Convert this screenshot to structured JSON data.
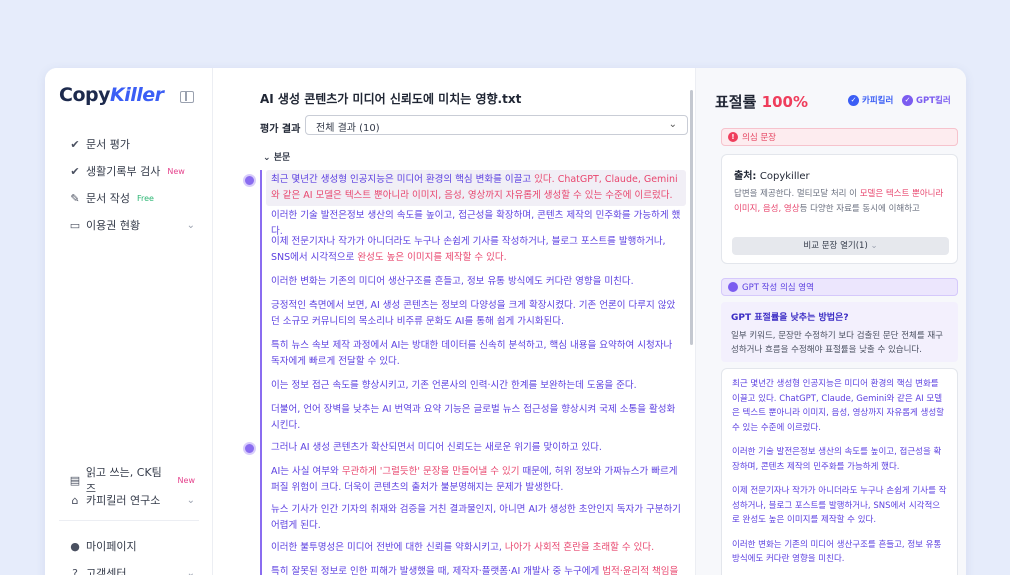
{
  "sidebar": {
    "logo": {
      "main": "Copy",
      "accent": "Killer"
    },
    "nav": [
      {
        "label": "문서 평가",
        "icon": "check-icon"
      },
      {
        "label": "생활기록부 검사",
        "badge": "New",
        "icon": "check-icon"
      },
      {
        "label": "문서 작성",
        "badge": "Free",
        "icon": "pen-icon"
      },
      {
        "label": "이용권 현황",
        "icon": "card-icon",
        "chevron": true
      }
    ],
    "bottom_nav": [
      {
        "label": "읽고 쓰는, CK팀즈",
        "badge": "New",
        "icon": "book-icon"
      },
      {
        "label": "카피킬러 연구소",
        "icon": "institute-icon",
        "chevron": true
      },
      {
        "label": "마이페이지",
        "icon": "user-icon"
      },
      {
        "label": "고객센터",
        "icon": "help-icon",
        "chevron": true
      }
    ]
  },
  "main": {
    "doc_title": "AI 생성 콘텐츠가 미디어 신뢰도에 미치는 영향.txt",
    "eval_label": "평가 결과",
    "eval_select_value": "전체 결과 (10)",
    "body_label": "본문",
    "groups": [
      {
        "paragraphs": [
          {
            "segments": [
              {
                "t": "최근 몇년간 생성형 인공지능은 미디어 환경의 핵심 변화를 이끌고 "
              },
              {
                "t": "있다. ChatGPT, Claude, Gemini와 같은 AI 모델은 텍스트 뿐아니라 이미지, 음성, 영상까지 자유롭게 생성할 수 있는 수준에 이르렀다.",
                "red": true
              }
            ],
            "highlight": true
          },
          {
            "segments": [
              {
                "t": "이러한 기술 발전은정보 생산의 속도를 높이고, 접근성을 확장하며, 콘텐츠 제작의 민주화를 가능하게 했다."
              }
            ]
          },
          {
            "segments": [
              {
                "t": "이제 전문기자나 작가가 아니더라도 누구나 손쉽게 기사를 작성하거나, 블로그 포스트를 발행하거나, SNS에서 시각적으로 "
              },
              {
                "t": "완성도 높은 이미지를 제작할 수 있다.",
                "red": true
              }
            ]
          },
          {
            "segments": [
              {
                "t": "이러한 변화는 기존의 미디어 생산구조를 흔들고, 정보 유통 방식에도 커다란 영향을 미친다."
              }
            ]
          },
          {
            "segments": [
              {
                "t": "긍정적인 측면에서 보면, AI 생성 콘텐츠는 정보의 다양성을 크게 확장시켰다. 기존 언론이 다루지 않았던 소규모 커뮤니티의 목소리나 비주류 문화도 AI를 통해 쉽게 가시화된다."
              }
            ]
          },
          {
            "segments": [
              {
                "t": "특히 뉴스 속보 제작 과정에서 AI는 방대한 데이터를 신속히 분석하고, 핵심 내용을 요약하여 시청자나 독자에게 빠르게 전달할 수 있다."
              }
            ]
          },
          {
            "segments": [
              {
                "t": "이는 정보 접근 속도를 향상시키고, 기존 언론사의 인력·시간 한계를 보완하는데 도움을 준다."
              }
            ]
          },
          {
            "segments": [
              {
                "t": "더불어, 언어 장벽을 낮추는 AI 번역과 요약 기능은 글로벌 뉴스 접근성을 향상시켜 국제 소통을 활성화 시킨다."
              }
            ]
          }
        ]
      },
      {
        "paragraphs": [
          {
            "segments": [
              {
                "t": "그러나 AI 생성 콘텐츠가 확산되면서 미디어 신뢰도는 새로운 위기를 맞이하고 있다."
              }
            ]
          },
          {
            "segments": [
              {
                "t": "AI는 사실 여부와 "
              },
              {
                "t": "무관하게 '그럴듯한' 문장을 만들어낼 수 있기",
                "red": true
              },
              {
                "t": " 때문에, 허위 정보와 가짜뉴스가 빠르게 퍼질 위험이 크다. 더욱이 콘텐츠의 출처가 불분명해지는 문제가 발생한다."
              }
            ]
          },
          {
            "segments": [
              {
                "t": "뉴스 기사가 인간 기자의 취재와 검증을 거친 결과물인지, 아니면 AI가 생성한 초안인지 독자가 구분하기 어렵게 된다."
              }
            ]
          },
          {
            "segments": [
              {
                "t": "이러한 불투명성은 미디어 전반에 대한 신뢰를 약화시키고, "
              },
              {
                "t": "나아가 사회적 혼란을 초래할 수 있다.",
                "red": true
              }
            ]
          },
          {
            "segments": [
              {
                "t": "특히 잘못된 정보로 인한 피해가 발생했을 때, 제작자·플랫폼·AI 개발사 중 누구에게 "
              },
              {
                "t": "법적·윤리적 책임을 물",
                "red": true
              }
            ]
          }
        ]
      }
    ]
  },
  "right": {
    "score_label": "표절률",
    "score_value": "100%",
    "brand_copykiller": "카피킬러",
    "brand_gpt": "GPT킬러",
    "suspect_label": "의심 문장",
    "source_label": "출처:",
    "source_name": "Copykiller",
    "source_text": [
      {
        "t": "답변을 제공한다. 멀티모달 처리 이 "
      },
      {
        "t": "모델은 텍스트 뿐아니라 이미지, 음성, 영상",
        "red": true
      },
      {
        "t": "등 다양한 자료를 동시에 이해하고"
      }
    ],
    "compare_button": "비교 문장 열기(1)",
    "gpt_section_label": "GPT 작성 의심 영역",
    "tip_question": "GPT 표절률을 낮추는 방법은?",
    "tip_answer": "일부 키워드, 문장만 수정하기 보다 검출된 문단 전체를 재구성하거나 흐름을 수정해야 표절률을 낮출 수 있습니다.",
    "ai_paragraphs": [
      "최근 몇년간 생성형 인공지능은 미디어 환경의 핵심 변화를 이끌고 있다. ChatGPT, Claude, Gemini와 같은 AI 모델은 텍스트 뿐아니라 이미지, 음성, 영상까지 자유롭게 생성할 수 있는 수준에 이르렀다.",
      "이러한 기술 발전은정보 생산의 속도를 높이고, 접근성을 확장하며, 콘텐츠 제작의 민주화를 가능하게 했다.",
      "이제 전문기자나 작가가 아니더라도 누구나 손쉽게 기사를 작성하거나, 블로그 포스트를 발행하거나, SNS에서 시각적으로 완성도 높은 이미지를 제작할 수 있다.",
      "이러한 변화는 기존의 미디어 생산구조를 흔들고, 정보 유통 방식에도 커다란 영향을 미친다."
    ]
  },
  "colors": {
    "accent": "#3b5ef5",
    "gpt_purple": "#5b3fe0",
    "plagiarism_red": "#e8466e"
  }
}
